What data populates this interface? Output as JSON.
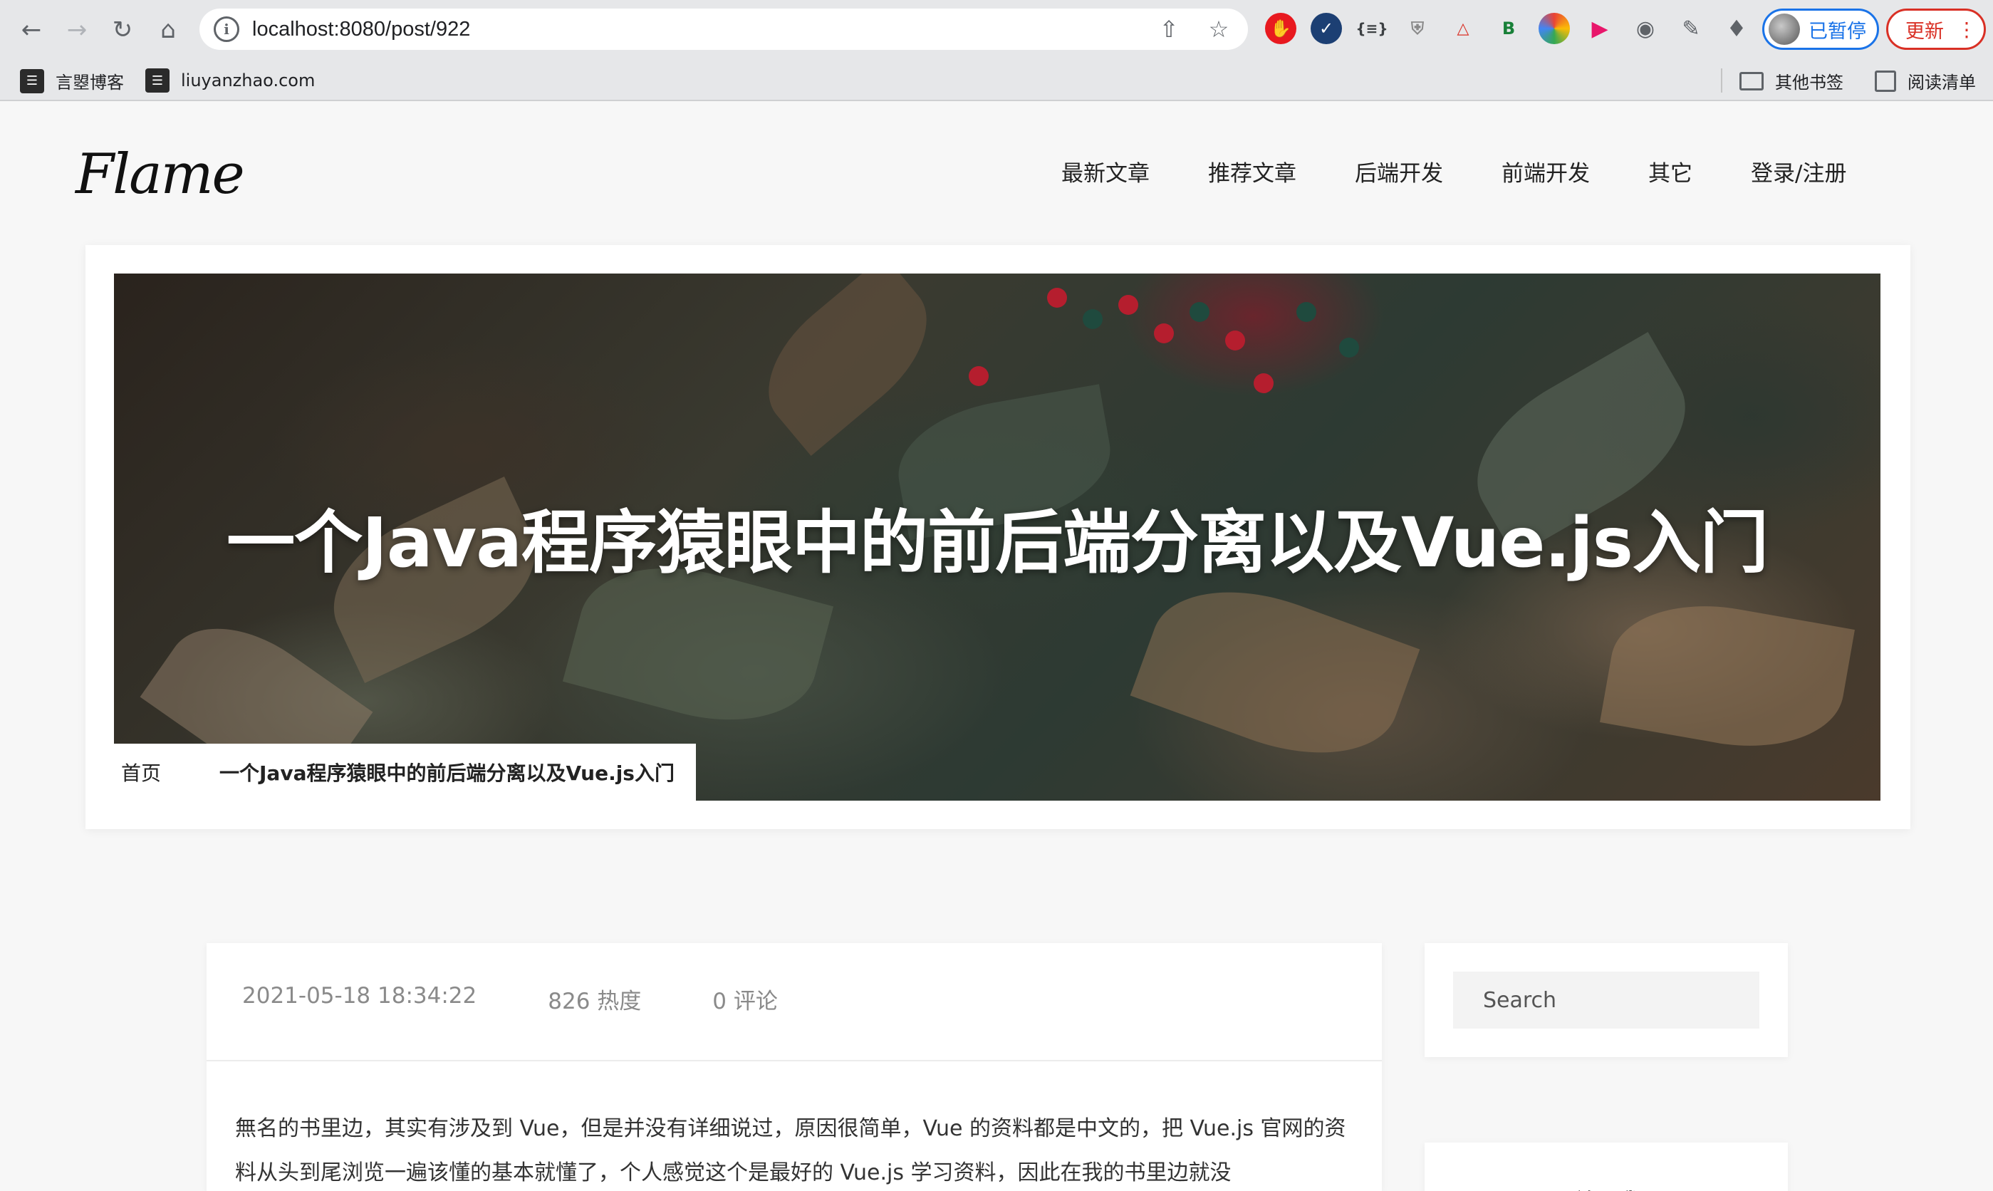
{
  "browser": {
    "url": "localhost:8080/post/922",
    "profile_label": "已暂停",
    "update_label": "更新",
    "bookmarks": [
      {
        "label": "言曌博客"
      },
      {
        "label": "liuyanzhao.com"
      }
    ],
    "other_bookmarks": "其他书签",
    "reading_list": "阅读清单"
  },
  "site": {
    "logo": "Flame",
    "nav": [
      "最新文章",
      "推荐文章",
      "后端开发",
      "前端开发",
      "其它",
      "登录/注册"
    ]
  },
  "post": {
    "title": "一个Java程序猿眼中的前后端分离以及Vue.js入门",
    "breadcrumb_home": "首页",
    "breadcrumb_current": "一个Java程序猿眼中的前后端分离以及Vue.js入门",
    "date": "2021-05-18 18:34:22",
    "heat": "826 热度",
    "comments": "0 评论",
    "content": "無名的书里边，其实有涉及到 Vue，但是并没有详细说过，原因很简单，Vue 的资料都是中文的，把 Vue.js 官网的资料从头到尾浏览一遍该懂的基本就懂了，个人感觉这个是最好的 Vue.js 学习资料，因此在我的书里边就没"
  },
  "sidebar": {
    "search_placeholder": "Search",
    "about_title": "关于我"
  }
}
